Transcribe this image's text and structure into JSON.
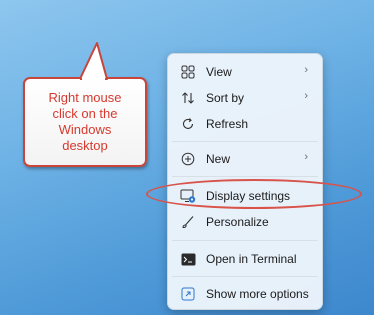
{
  "callout": {
    "text": "Right mouse\nclick on the\nWindows\ndesktop"
  },
  "context_menu": {
    "items": [
      {
        "label": "View",
        "icon": "grid-view-icon",
        "submenu": true
      },
      {
        "label": "Sort by",
        "icon": "sort-arrows-icon",
        "submenu": true
      },
      {
        "label": "Refresh",
        "icon": "refresh-icon",
        "submenu": false
      },
      {
        "label": "New",
        "icon": "plus-circle-icon",
        "submenu": true
      },
      {
        "label": "Display settings",
        "icon": "display-settings-icon",
        "submenu": false
      },
      {
        "label": "Personalize",
        "icon": "brush-icon",
        "submenu": false
      },
      {
        "label": "Open in Terminal",
        "icon": "terminal-icon",
        "submenu": false
      },
      {
        "label": "Show more options",
        "icon": "more-options-icon",
        "submenu": false
      }
    ],
    "chevron": "›"
  },
  "colors": {
    "accent_red": "#d63a2f",
    "menu_bg": "#ecf4fb",
    "desktop": "#5aa3dc"
  }
}
